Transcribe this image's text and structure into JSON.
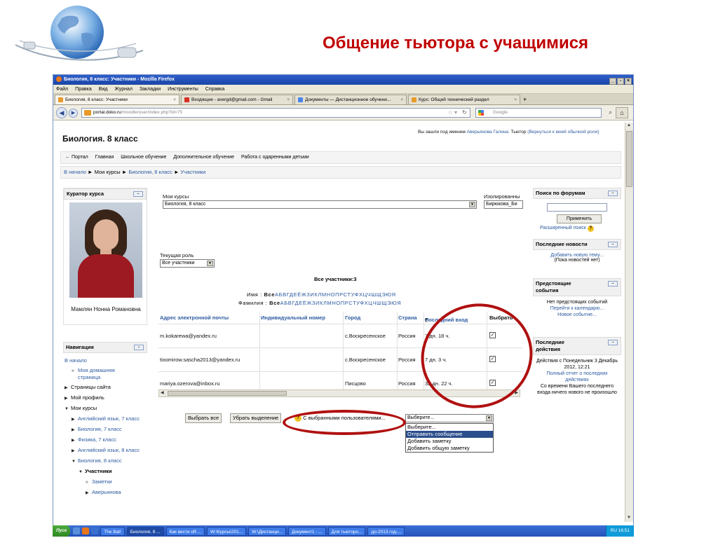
{
  "slide": {
    "title": "Общение тьютора с учащимися"
  },
  "browser": {
    "window_title": "Биология, 8 класс: Участники - Mozilla Firefox",
    "window_buttons": [
      "_",
      "▫",
      "×"
    ],
    "menu": [
      "Файл",
      "Правка",
      "Вид",
      "Журнал",
      "Закладки",
      "Инструменты",
      "Справка"
    ],
    "tabs": [
      {
        "label": "Биология, 8 класс: Участники",
        "close": "×"
      },
      {
        "label": "Входящие - avergd@gmail.com - Gmail",
        "close": "×"
      },
      {
        "label": "Документы — Дистанционное обучени...",
        "close": "×"
      },
      {
        "label": "Курс: Общий технический раздел",
        "close": "×"
      }
    ],
    "tab_plus": "+",
    "url_host": "portal.doko.ru",
    "url_path": "/moodle/user/index.php?id=75",
    "search_placeholder": "Google"
  },
  "page": {
    "course_title": "Биология. 8 класс",
    "login_info_prefix": "Вы зашли под именем",
    "login_user": "Аверьянова Галина:",
    "login_role": "Тьютор",
    "login_return": "(Вернуться к моей обычной роли)",
    "site_nav": [
      "← Портал",
      "Главная",
      "Школьное обучение",
      "Дополнительное обучение",
      "Работа с одаренными детьми"
    ],
    "breadcrumb": {
      "home": "В начало",
      "sep": "►",
      "my_courses": "Мои курсы",
      "course": "Биология, 8 класс",
      "current": "Участники"
    }
  },
  "curator": {
    "title": "Куратор курса",
    "name": "Мамлян Нонна Романовна",
    "toggle": "–"
  },
  "navigation": {
    "title": "Навигация",
    "toggle": "–",
    "items": [
      "В начало",
      "Моя домашняя страница",
      "Страницы сайта",
      "Мой профиль",
      "Мои курсы",
      "Английский язык, 7 класс",
      "Биология, 7 класс",
      "Физика, 7 класс",
      "Английский язык, 8 класс",
      "Биология, 8 класс",
      "Участники",
      "Заметки",
      "Аверьянова"
    ]
  },
  "main": {
    "my_courses_label": "Мои курсы",
    "my_courses_value": "Биология, 8 класс",
    "isolated_label": "Изолированны",
    "isolated_value": "Бирюкова_Би",
    "role_label": "Текущая роль",
    "role_value": "Все участники",
    "all_count": "Все участники:3",
    "name_prefix": "Имя :",
    "surname_prefix": "Фамилия :",
    "all_word": "Все",
    "letters": "АБВГДЕЁЖЗИКЛМНОПРСТУФХЦЧШЩЭЮЯ",
    "columns": [
      "Адрес электронной почты",
      "Индивидуальный номер",
      "Город",
      "Страна",
      "Последний вход",
      "Выбрать"
    ],
    "sort_arrow": "🡑",
    "rows": [
      {
        "email": "m.kokarewa@yandex.ru",
        "id": "",
        "city": "с.Воскресенское",
        "country": "Россия",
        "last": "7 дн. 18 ч.",
        "selected": "✓"
      },
      {
        "email": "tixomirow.sascha2013@yandex.ru",
        "id": "",
        "city": "с.Воскресенское",
        "country": "Россия",
        "last": "7 дн. 3 ч.",
        "selected": "✓"
      },
      {
        "email": "mariya.ozerova@inbox.ru",
        "id": "",
        "city": "Писцово",
        "country": "Россия",
        "last": "32 дн. 22 ч.",
        "selected": "✓"
      }
    ],
    "select_all": "Выбрать все",
    "deselect": "Убрать выделение",
    "with_selected": "С выбранными пользователями...",
    "with_selected_value": "Выберите...",
    "help": "?",
    "actions": [
      "Выберите...",
      "Отправить сообщение",
      "Добавить заметку",
      "Добавить общую заметку"
    ]
  },
  "sidebar_right": {
    "forum_title": "Поиск по форумам",
    "forum_apply": "Применить",
    "forum_adv": "Расширенный поиск",
    "news_title": "Последние новости",
    "news_add": "Добавить новую тему...",
    "news_none": "(Пока новостей нет)",
    "events_title": "Предстоящие события",
    "events_none": "Нет предстоящих событий",
    "events_calendar": "Перейти к календарю...",
    "events_new": "Новое событие...",
    "recent_title": "Последние действия",
    "recent_since": "Действия с Понедельник 3 Декабрь 2012, 12:21",
    "recent_full": "Полный отчет о последних действиях",
    "recent_none": "Со времени Вашего последнего входа ничего нового не произошло",
    "toggle": "–"
  },
  "taskbar": {
    "start": "Пуск",
    "tasks": [
      "The Bat!",
      "Биология, 8 ...",
      "Как вести off-...",
      "W:\\Курсы\\201...",
      "W:\\Дистанци...",
      "Документ1 - ...",
      "Для тьюторо...",
      "до-2013 год-..."
    ],
    "tray_lang": "RU",
    "clock": "16:51"
  }
}
